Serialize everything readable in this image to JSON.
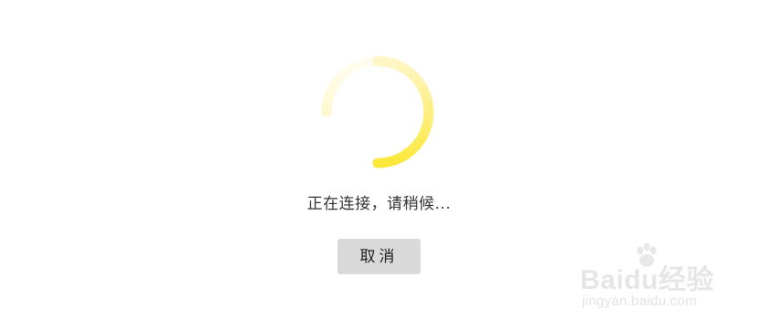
{
  "loading": {
    "status_text": "正在连接，请稍候...",
    "cancel_label": "取消",
    "spinner_color": "#f9e94a"
  },
  "watermark": {
    "logo_text": "Baidu经验",
    "url_text": "jingyan.baidu.com"
  }
}
